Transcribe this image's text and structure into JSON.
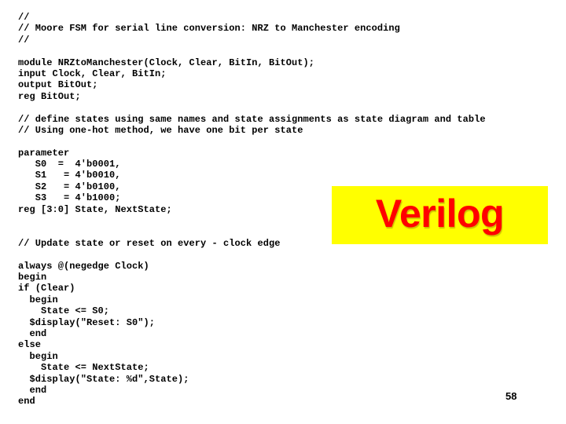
{
  "slide": {
    "code_lines": [
      "//",
      "// Moore FSM for serial line conversion: NRZ to Manchester encoding",
      "//",
      "",
      "module NRZtoManchester(Clock, Clear, BitIn, BitOut);",
      "input Clock, Clear, BitIn;",
      "output BitOut;",
      "reg BitOut;",
      "",
      "// define states using same names and state assignments as state diagram and table",
      "// Using one-hot method, we have one bit per state",
      "",
      "parameter",
      "   S0  =  4'b0001,",
      "   S1   = 4'b0010,",
      "   S2   = 4'b0100,",
      "   S3   = 4'b1000;",
      "reg [3:0] State, NextState;",
      "",
      "",
      "// Update state or reset on every - clock edge",
      "",
      "always @(negedge Clock)",
      "begin",
      "if (Clear)",
      "  begin",
      "    State <= S0;",
      "  $display(\"Reset: S0\");",
      "  end",
      "else",
      "  begin",
      "    State <= NextState;",
      "  $display(\"State: %d\",State);",
      "  end",
      "end"
    ],
    "badge": {
      "label": "Verilog",
      "background_color": "#ffff00",
      "text_color": "#ff0000"
    },
    "page_number": "58"
  }
}
